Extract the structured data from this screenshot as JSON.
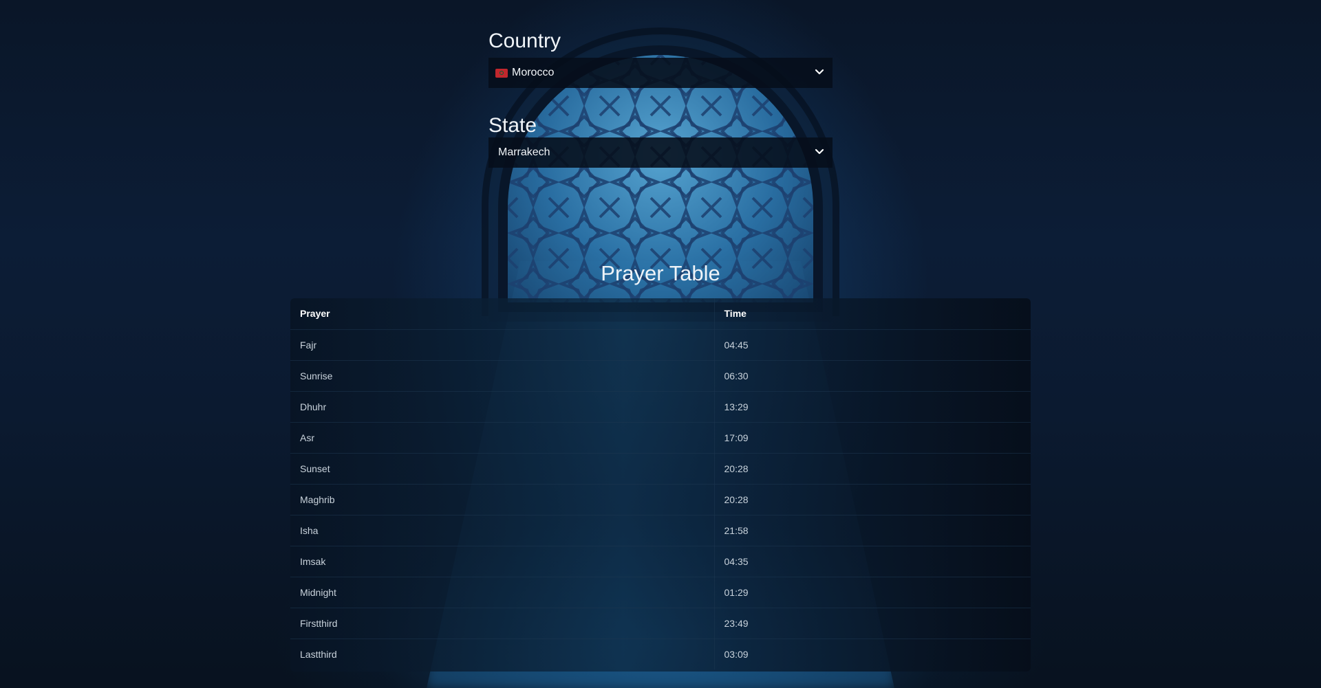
{
  "country": {
    "label": "Country",
    "selected": "Morocco",
    "flag_icon": "morocco-flag-icon"
  },
  "state": {
    "label": "State",
    "selected": "Marrakech"
  },
  "prayer_table": {
    "title": "Prayer Table",
    "headers": [
      "Prayer",
      "Time"
    ],
    "rows": [
      {
        "prayer": "Fajr",
        "time": "04:45"
      },
      {
        "prayer": "Sunrise",
        "time": "06:30"
      },
      {
        "prayer": "Dhuhr",
        "time": "13:29"
      },
      {
        "prayer": "Asr",
        "time": "17:09"
      },
      {
        "prayer": "Sunset",
        "time": "20:28"
      },
      {
        "prayer": "Maghrib",
        "time": "20:28"
      },
      {
        "prayer": "Isha",
        "time": "21:58"
      },
      {
        "prayer": "Imsak",
        "time": "04:35"
      },
      {
        "prayer": "Midnight",
        "time": "01:29"
      },
      {
        "prayer": "Firstthird",
        "time": "23:49"
      },
      {
        "prayer": "Lastthird",
        "time": "03:09"
      }
    ]
  },
  "colors": {
    "background": "#0b1a30",
    "select_background": "#060e1a",
    "accent_light": "#5aaad7"
  }
}
